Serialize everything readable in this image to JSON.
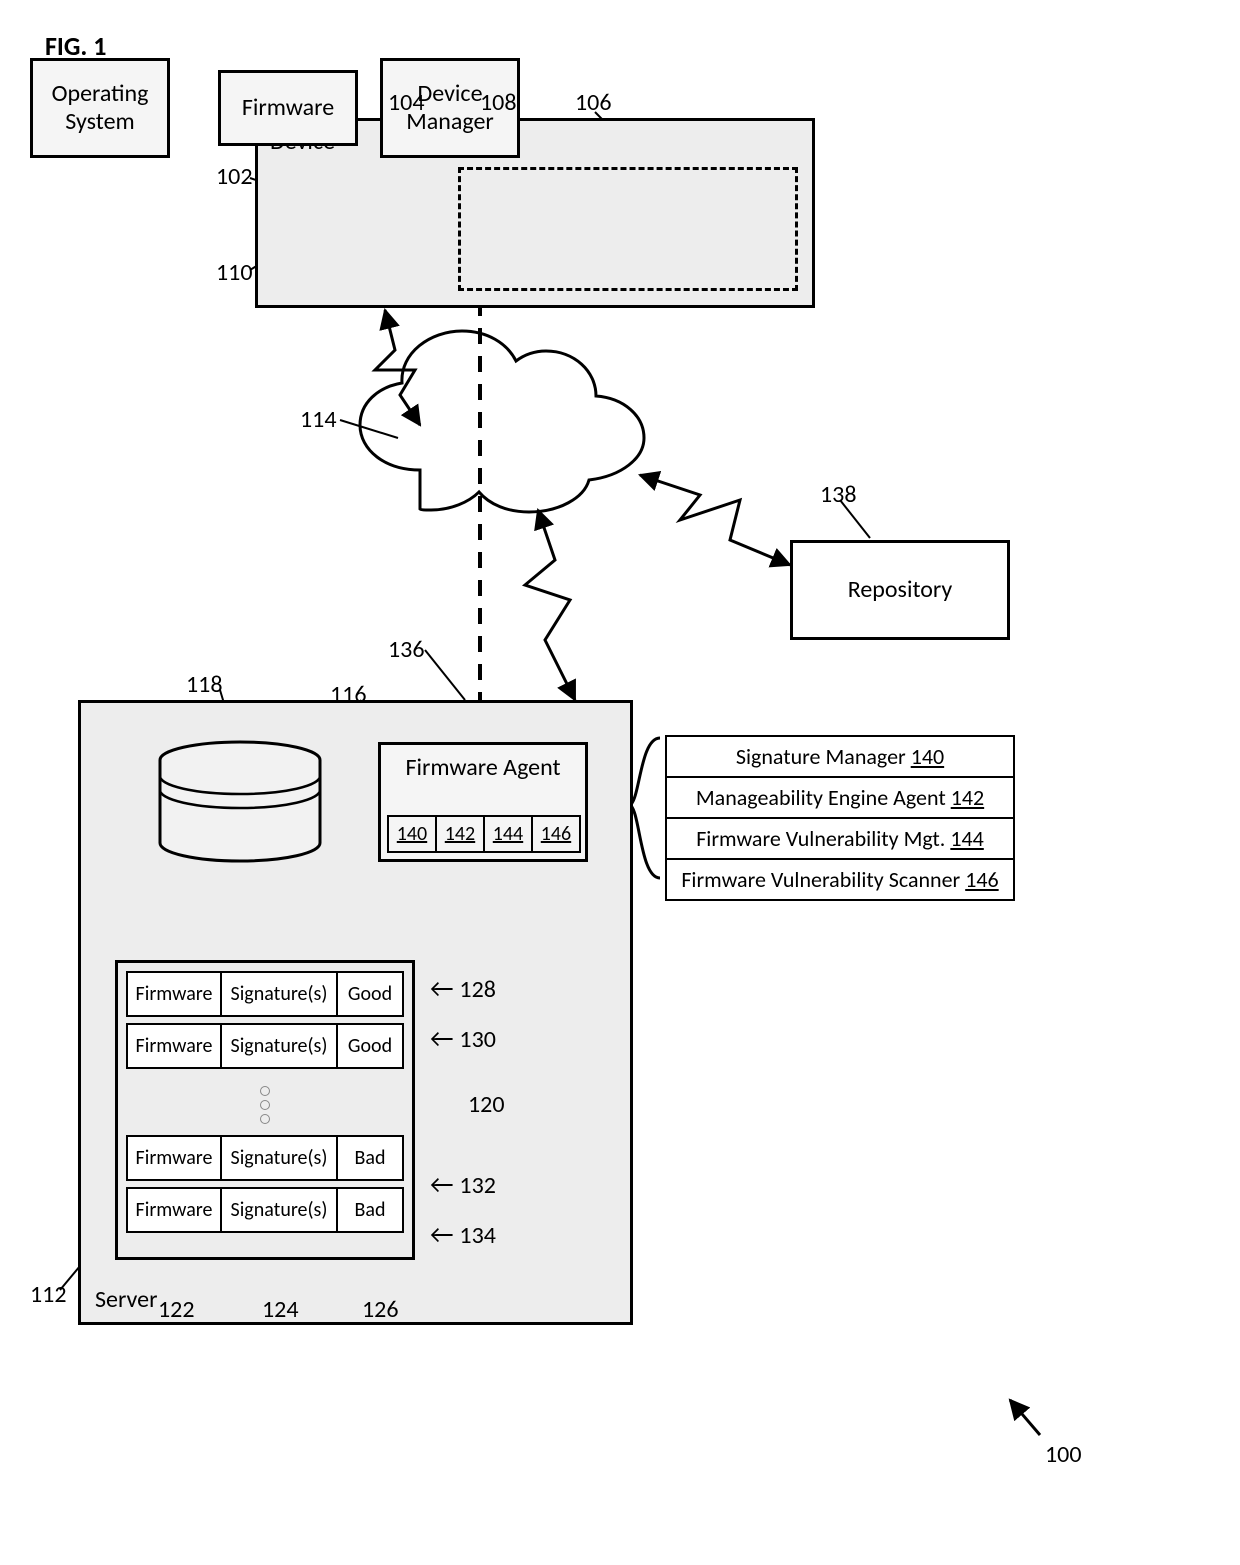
{
  "figure_label": "FIG. 1",
  "device": {
    "title": "Device",
    "os": "Operating\nSystem",
    "firmware": "Firmware",
    "dev_mgr": "Device\nManager"
  },
  "repository": "Repository",
  "cloud_ref": "114",
  "server": {
    "title": "Server",
    "firmware_agent": {
      "title": "Firmware Agent",
      "cells": [
        "140",
        "142",
        "144",
        "146"
      ]
    },
    "records": {
      "cols": [
        "Firmware",
        "Signature(s)",
        "Good"
      ],
      "rows": [
        {
          "c1": "Firmware",
          "c2": "Signature(s)",
          "c3": "Good",
          "ref": "128"
        },
        {
          "c1": "Firmware",
          "c2": "Signature(s)",
          "c3": "Good",
          "ref": "130"
        },
        {
          "c1": "Firmware",
          "c2": "Signature(s)",
          "c3": "Bad",
          "ref": "132"
        },
        {
          "c1": "Firmware",
          "c2": "Signature(s)",
          "c3": "Bad",
          "ref": "134"
        }
      ],
      "col_refs": {
        "c1": "122",
        "c2": "124",
        "c3": "126"
      },
      "group_ref": "120"
    }
  },
  "legend": [
    {
      "text": "Signature Manager",
      "ref": "140"
    },
    {
      "text": "Manageability Engine Agent",
      "ref": "142"
    },
    {
      "text": "Firmware Vulnerability Mgt.",
      "ref": "144"
    },
    {
      "text": "Firmware Vulnerability Scanner",
      "ref": "146"
    }
  ],
  "refs": {
    "device_outer": "102",
    "firmware": "104",
    "dashed": "108",
    "dev_mgr": "106",
    "os": "110",
    "server_outer": "112",
    "fa": "116",
    "db": "118",
    "repo": "138",
    "fa_leader": "136",
    "corner": "100"
  }
}
